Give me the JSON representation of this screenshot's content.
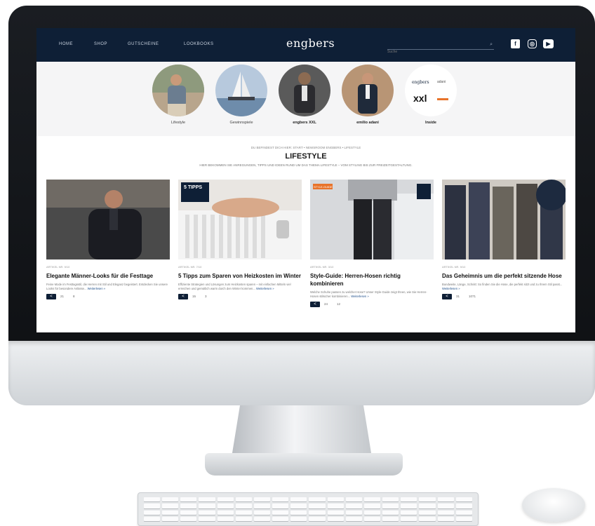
{
  "nav": {
    "items": [
      "HOME",
      "SHOP",
      "GUTSCHEINE",
      "LOOKBOOKS"
    ],
    "logo": "engbers",
    "search_placeholder": "Suche"
  },
  "social": {
    "facebook": "f",
    "instagram": "◎",
    "youtube": "▶"
  },
  "categories": [
    {
      "label": "Lifestyle"
    },
    {
      "label": "Gewinnspiele"
    },
    {
      "label": "engbers XXL"
    },
    {
      "label": "emilio adani"
    },
    {
      "label": "Inside"
    }
  ],
  "brand_logos": {
    "engbers": "engbers",
    "adani": "adani",
    "xxl": "xxl"
  },
  "breadcrumb": "DU BEFINDEST DICH HIER: START • NEWSROOM ENGBERS • LIFESTYLE",
  "page_title": "LIFESTYLE",
  "intro": "HIER BEKOMMEN SIE ANREGUNGEN, TIPPS UND IDEEN RUND UM DAS THEMA LIFESTYLE – VOM STYLING BIS ZUR FREIZEITGESTALTUNG.",
  "articles": [
    {
      "date": "ARTIKEL NR. 9/10",
      "title": "Elegante Männer-Looks für die Festtage",
      "excerpt": "Feine Mode im Festtagsstil, die Herren mit Stil und Eleganz begeistert. Entdecken Sie unsere Looks für besondere Anlässe...",
      "more": "Weiterlesen »",
      "likes": "21",
      "comments": "8"
    },
    {
      "date": "ARTIKEL NR. 7/10",
      "title": "5 Tipps zum Sparen von Heizkosten im Winter",
      "excerpt": "Effiziente Strategien und Lösungen zum Heizkosten sparen – mit einfachen Mitteln viel erreichen und gemütlich warm durch den Winter kommen...",
      "more": "Weiterlesen »",
      "likes": "15",
      "comments": "3",
      "badge": "5 TIPPS"
    },
    {
      "date": "ARTIKEL NR. 3/10",
      "title": "Style-Guide: Herren-Hosen richtig kombinieren",
      "excerpt": "Welche Schuhe passen zu welcher Hose? Unser Style-Guide zeigt Ihnen, wie Sie Herren-Hosen stilsicher kombinieren...",
      "more": "Weiterlesen »",
      "likes": "24",
      "comments": "12",
      "badge": "STYLE-GUIDE"
    },
    {
      "date": "ARTIKEL NR. 9/10",
      "title": "Das Geheimnis um die perfekt sitzende Hose",
      "excerpt": "Bundweite, Länge, Schnitt: So finden Sie die Hose, die perfekt sitzt und zu Ihrem Stil passt...",
      "more": "Weiterlesen »",
      "likes": "31",
      "comments": "1071"
    }
  ],
  "colors": {
    "navbar": "#0e1f36",
    "accent": "#1f4f8a",
    "orange_badge": "#e8732a"
  }
}
